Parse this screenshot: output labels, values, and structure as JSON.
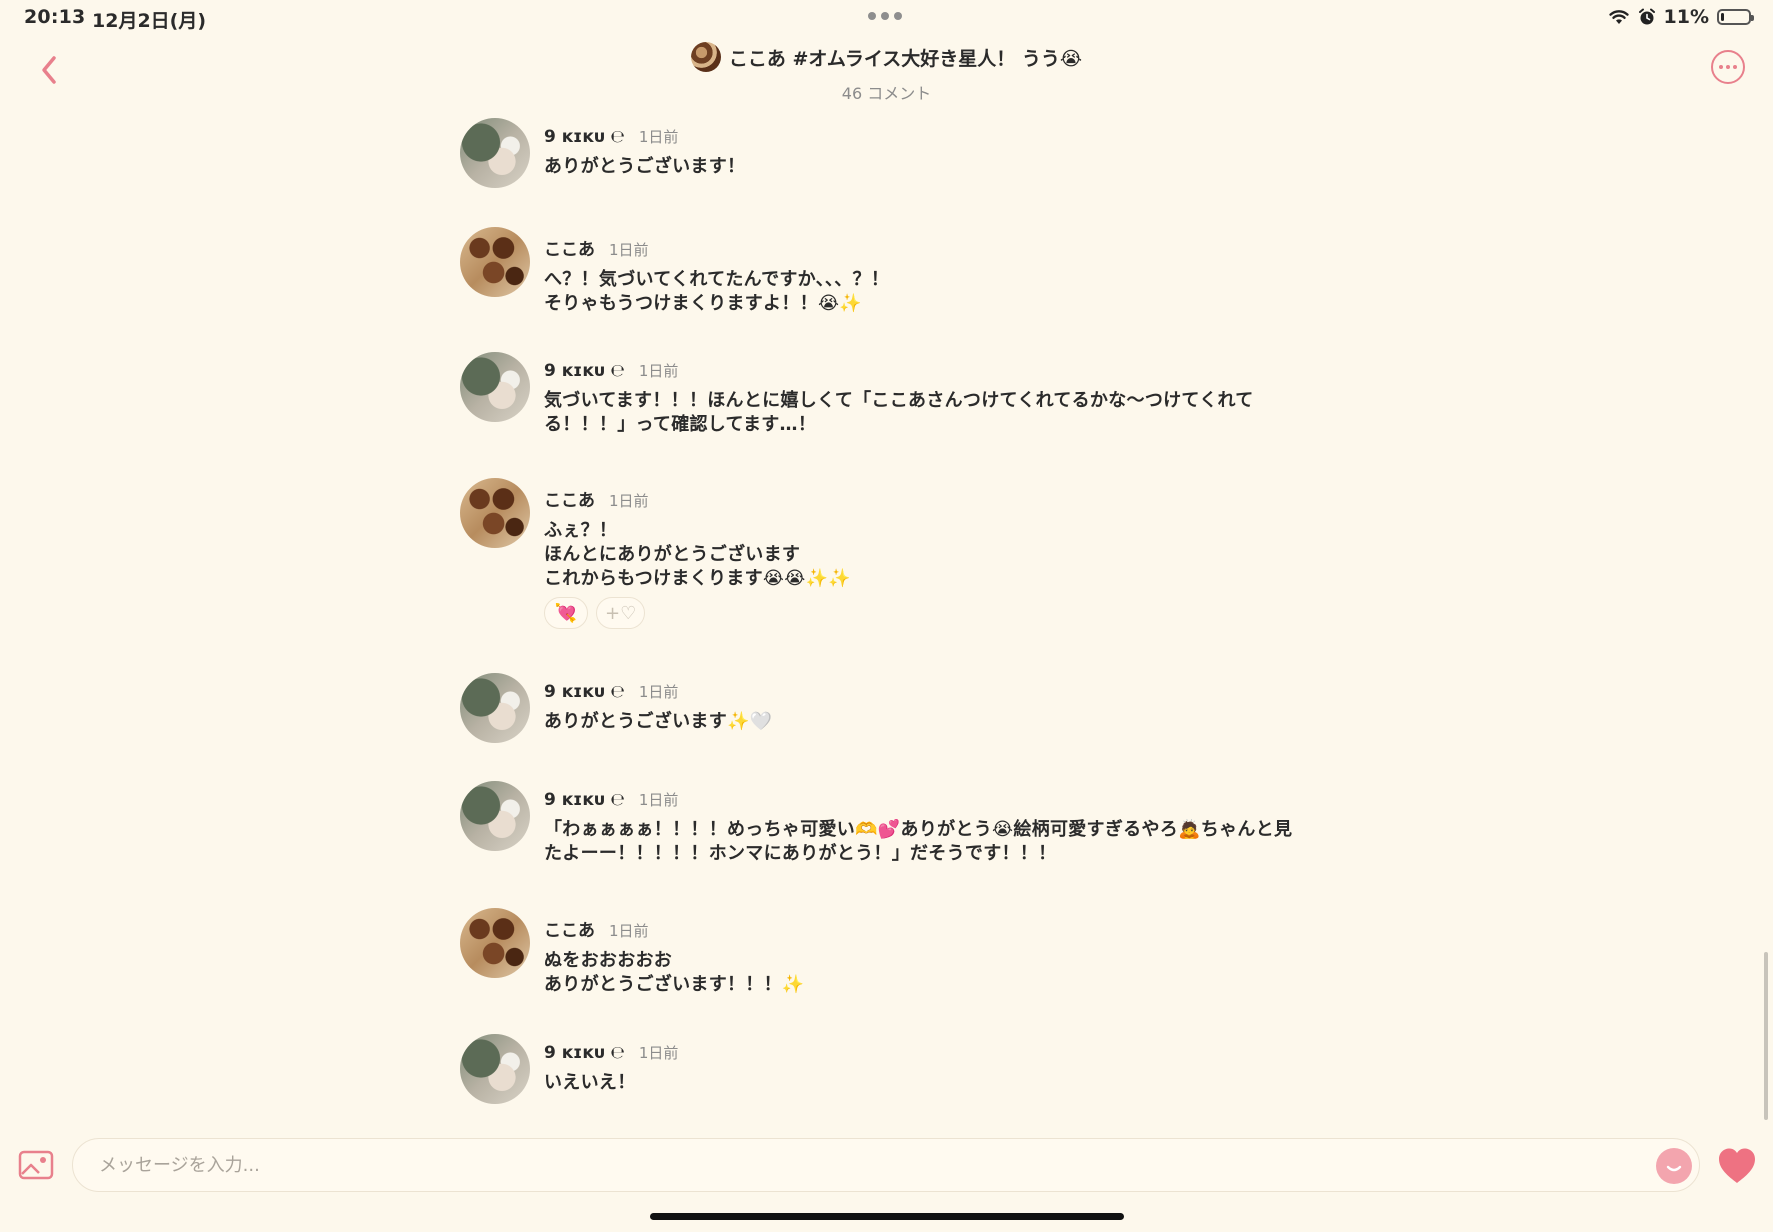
{
  "status_bar": {
    "time": "20:13",
    "date": "12月2日(月)",
    "battery": "11%",
    "battery_level": 0.11
  },
  "header": {
    "title": "ここあ #オムライス大好き星人！ うう😭",
    "subtitle": "46 コメント"
  },
  "comments": [
    {
      "user": "9 ᴋɪᴋᴜ ℮",
      "time": "1日前",
      "text": "ありがとうございます！",
      "avatar": "kiku"
    },
    {
      "user": "ここあ",
      "time": "1日前",
      "text": "へ？！気づいてくれてたんですか、、、？！\nそりゃもうつけまくりますよ！！😭✨",
      "avatar": "kokoa"
    },
    {
      "user": "9 ᴋɪᴋᴜ ℮",
      "time": "1日前",
      "text": "気づいてます！！！ほんとに嬉しくて「ここあさんつけてくれてるかな〜つけてくれて\nる！！！」って確認してます…！",
      "avatar": "kiku"
    },
    {
      "user": "ここあ",
      "time": "1日前",
      "text": "ふぇ？！\nほんとにありがとうございます\nこれからもつけまくります😭😭✨✨",
      "avatar": "kokoa",
      "reactions": [
        "💘",
        "+♡"
      ]
    },
    {
      "user": "9 ᴋɪᴋᴜ ℮",
      "time": "1日前",
      "text": "ありがとうございます✨🤍",
      "avatar": "kiku"
    },
    {
      "user": "9 ᴋɪᴋᴜ ℮",
      "time": "1日前",
      "text": "「わぁぁぁぁ！！！！めっちゃ可愛い🫶💕ありがとう😭絵柄可愛すぎるやろ🙇ちゃんと見\nたよーー！！！！！ホンマにありがとう！」だそうです！！！",
      "avatar": "kiku"
    },
    {
      "user": "ここあ",
      "time": "1日前",
      "text": "ぬをおおおおお\nありがとうございます！！！✨",
      "avatar": "kokoa"
    },
    {
      "user": "9 ᴋɪᴋᴜ ℮",
      "time": "1日前",
      "text": "いえいえ！",
      "avatar": "kiku"
    }
  ],
  "input": {
    "placeholder": "メッセージを入力..."
  },
  "icons": {
    "back": "chevron-left-icon",
    "more": "more-horizontal-icon",
    "image": "image-icon",
    "emoji": "emoji-icon",
    "heart": "heart-icon"
  },
  "colors": {
    "background": "#fdf8ec",
    "accent": "#e8808c"
  }
}
